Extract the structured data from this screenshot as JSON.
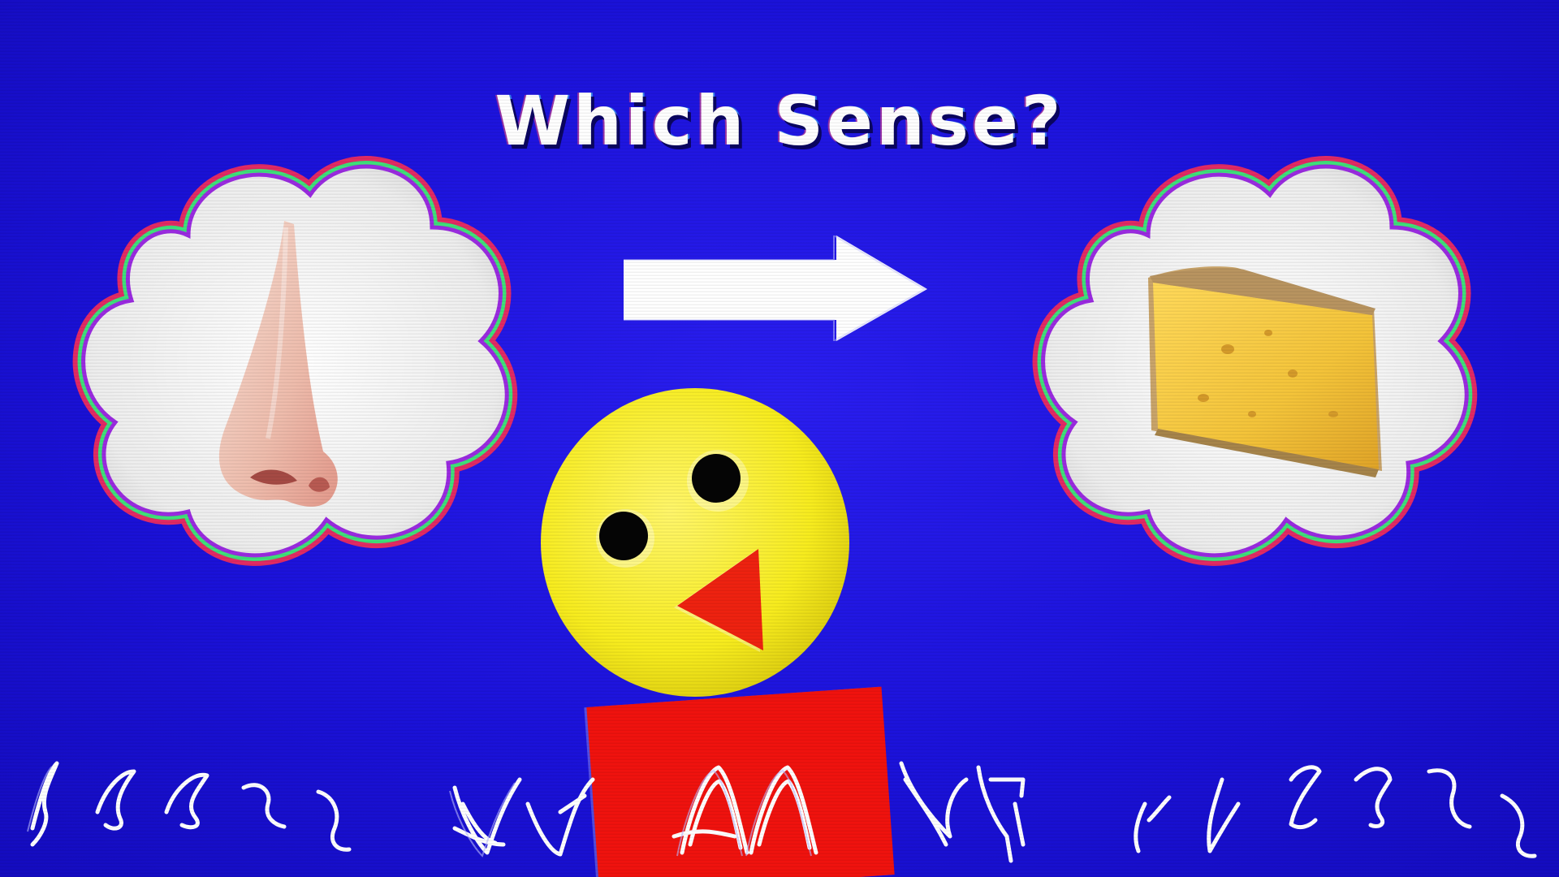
{
  "screen": {
    "title": "Which Sense?"
  },
  "colors": {
    "background": "#1b12da",
    "face_yellow": "#f7ec1e",
    "beak_red": "#f0120e",
    "cheese_yellow": "#f4c43a",
    "nose_skin": "#f1c9b8",
    "cloud_white": "#f2f2f2"
  },
  "icons": {
    "left_bubble": "nose-icon",
    "right_bubble": "cheese-icon",
    "arrow": "arrow-right-icon",
    "mascot": "mascot-face-icon"
  }
}
